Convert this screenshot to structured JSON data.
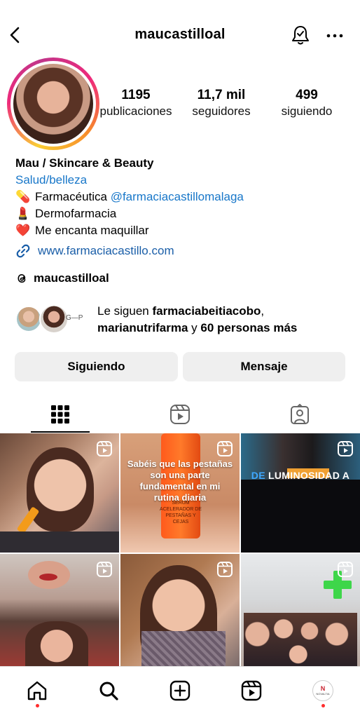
{
  "header": {
    "username": "maucastilloal",
    "back_icon": "chevron-left-icon",
    "bell_icon": "bell-check-icon",
    "more_icon": "more-horizontal-icon"
  },
  "profile": {
    "stats": [
      {
        "value": "1195",
        "label": "publicaciones"
      },
      {
        "value": "11,7 mil",
        "label": "seguidores"
      },
      {
        "value": "499",
        "label": "siguiendo"
      }
    ],
    "display_name": "Mau / Skincare & Beauty",
    "category": "Salud/belleza",
    "bio_lines": [
      {
        "emoji": "💊",
        "text": "Farmacéutica ",
        "mention": "@farmaciacastillomalaga"
      },
      {
        "emoji": "💄",
        "text": "Dermofarmacia"
      },
      {
        "emoji": "❤️",
        "text": "Me encanta maquillar"
      }
    ],
    "website": "www.farmaciacastillo.com",
    "threads_handle": "maucastilloal"
  },
  "followed_by": {
    "prefix": "Le siguen ",
    "name1": "farmaciabeitiacobo",
    "sep": ",",
    "name2": "marianutrifarma",
    "mid": " y ",
    "others": "60 personas más",
    "third_avatar_text": "G—P"
  },
  "actions": {
    "following_label": "Siguiendo",
    "message_label": "Mensaje"
  },
  "tabs": [
    "grid-icon",
    "reels-icon",
    "tagged-icon"
  ],
  "posts": {
    "post2_caption": "Sabéis que las pestañas son una parte fundamental en mi rutina diaria",
    "post2_product_text": "SÉRUM ACELERADOR DE PESTAÑAS Y CEJAS",
    "post3_caption_accent": "DE",
    "post3_caption_rest": " LUMINOSIDAD A"
  },
  "bottom_nav": {
    "items": [
      "home-icon",
      "search-icon",
      "create-icon",
      "reels-icon",
      "profile-avatar"
    ],
    "avatar_mark": "N",
    "avatar_text": "NOVALTIA"
  },
  "colors": {
    "link": "#1877c9",
    "button_bg": "#efefef",
    "notification_dot": "#ff2d2d"
  }
}
